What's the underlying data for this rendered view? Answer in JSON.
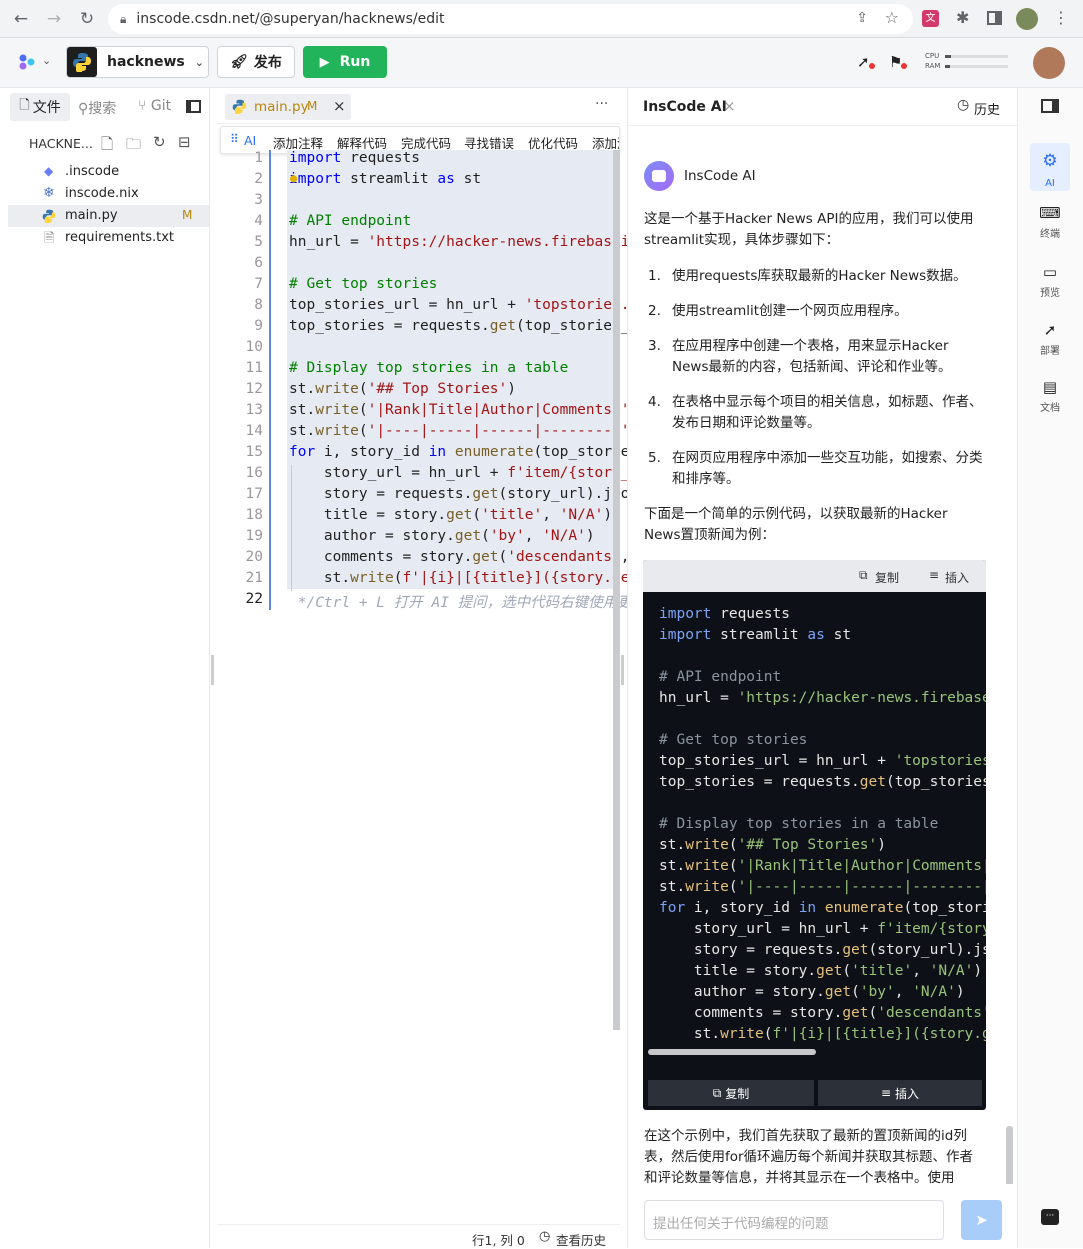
{
  "browser": {
    "url": "inscode.csdn.net/@superyan/hacknews/edit"
  },
  "app": {
    "project": "hacknews",
    "publish": "发布",
    "run": "Run",
    "cpu": "CPU",
    "ram": "RAM"
  },
  "sidebar": {
    "tab_files": "文件",
    "tab_search": "搜索",
    "tab_git": "Git",
    "folder": "HACKNE...",
    "files": [
      {
        "name": ".inscode"
      },
      {
        "name": "inscode.nix"
      },
      {
        "name": "main.py",
        "badge": "M"
      },
      {
        "name": "requirements.txt"
      }
    ]
  },
  "editor": {
    "tab": "main.py",
    "tab_badge": "M",
    "more": "···",
    "ai_label": "AI",
    "toolbar": [
      "添加注释",
      "解释代码",
      "完成代码",
      "寻找错误",
      "优化代码",
      "添加测"
    ],
    "lines": [
      {
        "n": "1",
        "t": "import requests"
      },
      {
        "n": "2",
        "t": "import streamlit as st"
      },
      {
        "n": "3",
        "t": ""
      },
      {
        "n": "4",
        "t": "# API endpoint"
      },
      {
        "n": "5",
        "t": "hn_url = 'https://hacker-news.firebasei"
      },
      {
        "n": "6",
        "t": ""
      },
      {
        "n": "7",
        "t": "# Get top stories"
      },
      {
        "n": "8",
        "t": "top_stories_url = hn_url + 'topstories."
      },
      {
        "n": "9",
        "t": "top_stories = requests.get(top_stories_"
      },
      {
        "n": "10",
        "t": ""
      },
      {
        "n": "11",
        "t": "# Display top stories in a table"
      },
      {
        "n": "12",
        "t": "st.write('## Top Stories')"
      },
      {
        "n": "13",
        "t": "st.write('|Rank|Title|Author|Comments|'"
      },
      {
        "n": "14",
        "t": "st.write('|----|-----|------|--------|'"
      },
      {
        "n": "15",
        "t": "for i, story_id in enumerate(top_storie"
      },
      {
        "n": "16",
        "t": "    story_url = hn_url + f'item/{story_"
      },
      {
        "n": "17",
        "t": "    story = requests.get(story_url).jso"
      },
      {
        "n": "18",
        "t": "    title = story.get('title', 'N/A')"
      },
      {
        "n": "19",
        "t": "    author = story.get('by', 'N/A')"
      },
      {
        "n": "20",
        "t": "    comments = story.get('descendants',"
      },
      {
        "n": "21",
        "t": "    st.write(f'|{i}|[{title}]({story.ge"
      },
      {
        "n": "22",
        "t": " */Ctrl + L 打开 AI 提问，选中代码右键使用更"
      }
    ],
    "status_pos": "行1, 列 0",
    "status_history": "查看历史"
  },
  "ai": {
    "title": "InsCode AI",
    "history": "历史",
    "bot_name": "InsCode AI",
    "intro": "这是一个基于Hacker News API的应用，我们可以使用streamlit实现，具体步骤如下：",
    "steps": [
      {
        "num": "1.",
        "text": "使用requests库获取最新的Hacker News数据。"
      },
      {
        "num": "2.",
        "text": "使用streamlit创建一个网页应用程序。"
      },
      {
        "num": "3.",
        "text": "在应用程序中创建一个表格，用来显示Hacker News最新的内容，包括新闻、评论和作业等。"
      },
      {
        "num": "4.",
        "text": "在表格中显示每个项目的相关信息，如标题、作者、发布日期和评论数量等。"
      },
      {
        "num": "5.",
        "text": "在网页应用程序中添加一些交互功能，如搜索、分类和排序等。"
      }
    ],
    "code_intro": "下面是一个简单的示例代码，以获取最新的Hacker News置顶新闻为例：",
    "copy": "复制",
    "insert": "插入",
    "code": [
      "import requests",
      "import streamlit as st",
      "",
      "# API endpoint",
      "hn_url = 'https://hacker-news.firebasei",
      "",
      "# Get top stories",
      "top_stories_url = hn_url + 'topstories.",
      "top_stories = requests.get(top_stories_",
      "",
      "# Display top stories in a table",
      "st.write('## Top Stories')",
      "st.write('|Rank|Title|Author|Comments|'",
      "st.write('|----|-----|------|--------|'",
      "for i, story_id in enumerate(top_storie",
      "    story_url = hn_url + f'item/{story_",
      "    story = requests.get(story_url).jso",
      "    title = story.get('title', 'N/A')",
      "    author = story.get('by', 'N/A')",
      "    comments = story.get('descendants',",
      "    st.write(f'|{i}|[{title}]({story.ge"
    ],
    "outro": "在这个示例中，我们首先获取了最新的置顶新闻的id列表，然后使用for循环遍历每个新闻并获取其标题、作者和评论数量等信息，并将其显示在一个表格中。使用",
    "input_placeholder": "提出任何关于代码编程的问题"
  },
  "rail": [
    {
      "label": "AI"
    },
    {
      "label": "终端"
    },
    {
      "label": "预览"
    },
    {
      "label": "部署"
    },
    {
      "label": "文档"
    }
  ]
}
